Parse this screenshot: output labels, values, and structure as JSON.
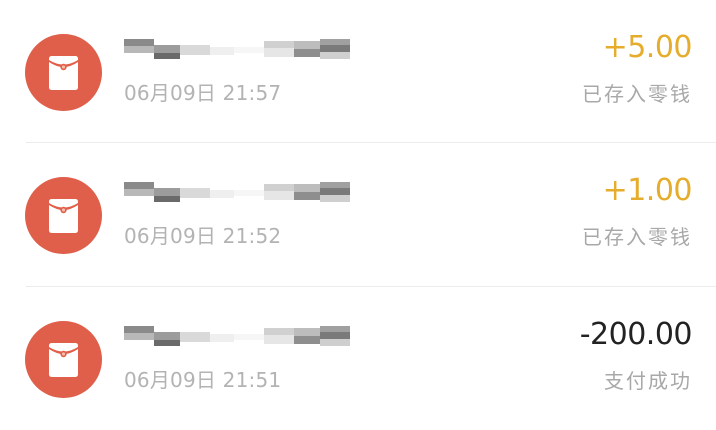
{
  "colors": {
    "avatar_bg": "#e05f4a",
    "income_amount": "#e6ad2c",
    "expense_amount": "#222222",
    "secondary_text": "#b3b3b3"
  },
  "transactions": [
    {
      "icon": "red-packet-icon",
      "name": "",
      "timestamp": "06月09日 21:57",
      "amount": "+5.00",
      "type": "income",
      "status": "已存入零钱"
    },
    {
      "icon": "red-packet-icon",
      "name": "",
      "timestamp": "06月09日 21:52",
      "amount": "+1.00",
      "type": "income",
      "status": "已存入零钱"
    },
    {
      "icon": "red-packet-icon",
      "name": "",
      "timestamp": "06月09日 21:51",
      "amount": "-200.00",
      "type": "expense",
      "status": "支付成功"
    }
  ]
}
